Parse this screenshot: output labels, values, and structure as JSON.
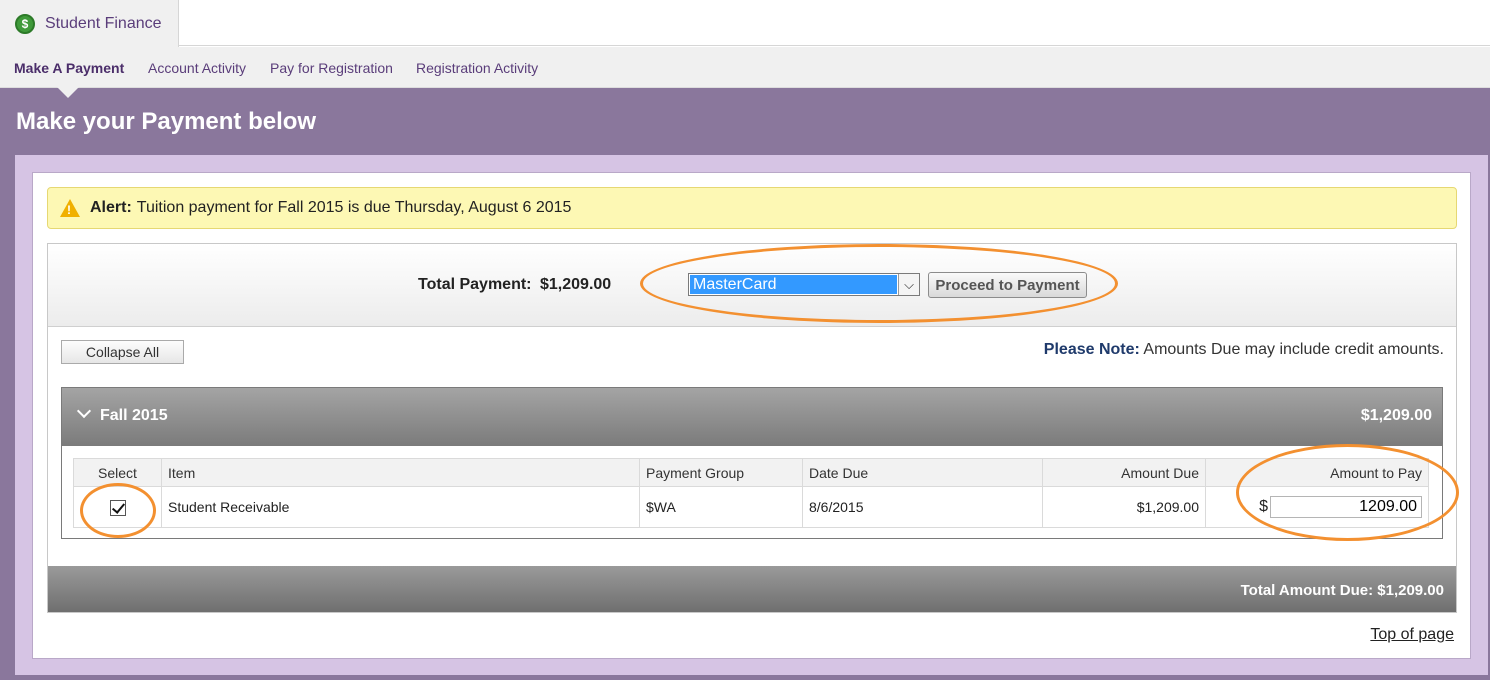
{
  "app": {
    "title": "Student Finance",
    "icon": "dollar-icon"
  },
  "nav": {
    "items": [
      {
        "label": "Make A Payment",
        "active": true
      },
      {
        "label": "Account Activity",
        "active": false
      },
      {
        "label": "Pay for Registration",
        "active": false
      },
      {
        "label": "Registration Activity",
        "active": false
      }
    ]
  },
  "page": {
    "title": "Make your Payment below"
  },
  "alert": {
    "icon": "warning-icon",
    "label": "Alert:",
    "message": "Tuition payment for Fall 2015 is due Thursday, August 6 2015"
  },
  "payment": {
    "total_label": "Total Payment:",
    "total_value": "$1,209.00",
    "method_selected": "MasterCard",
    "proceed_label": "Proceed to Payment"
  },
  "controls": {
    "collapse_label": "Collapse All"
  },
  "note": {
    "label": "Please Note:",
    "text": "Amounts Due may include credit amounts."
  },
  "term": {
    "name": "Fall 2015",
    "amount": "$1,209.00",
    "columns": [
      "Select",
      "Item",
      "Payment Group",
      "Date Due",
      "Amount Due",
      "Amount to Pay"
    ],
    "rows": [
      {
        "selected": true,
        "item": "Student Receivable",
        "payment_group": "$WA",
        "date_due": "8/6/2015",
        "amount_due": "$1,209.00",
        "currency": "$",
        "amount_to_pay": "1209.00"
      }
    ]
  },
  "footer": {
    "total_due": "Total Amount Due: $1,209.00",
    "top_link": "Top of page"
  },
  "colors": {
    "accent": "#8a779c",
    "panel": "#d6c4e4",
    "alert_bg": "#fdf8b4",
    "annotation": "#f39030",
    "select_highlight": "#3399ff"
  }
}
